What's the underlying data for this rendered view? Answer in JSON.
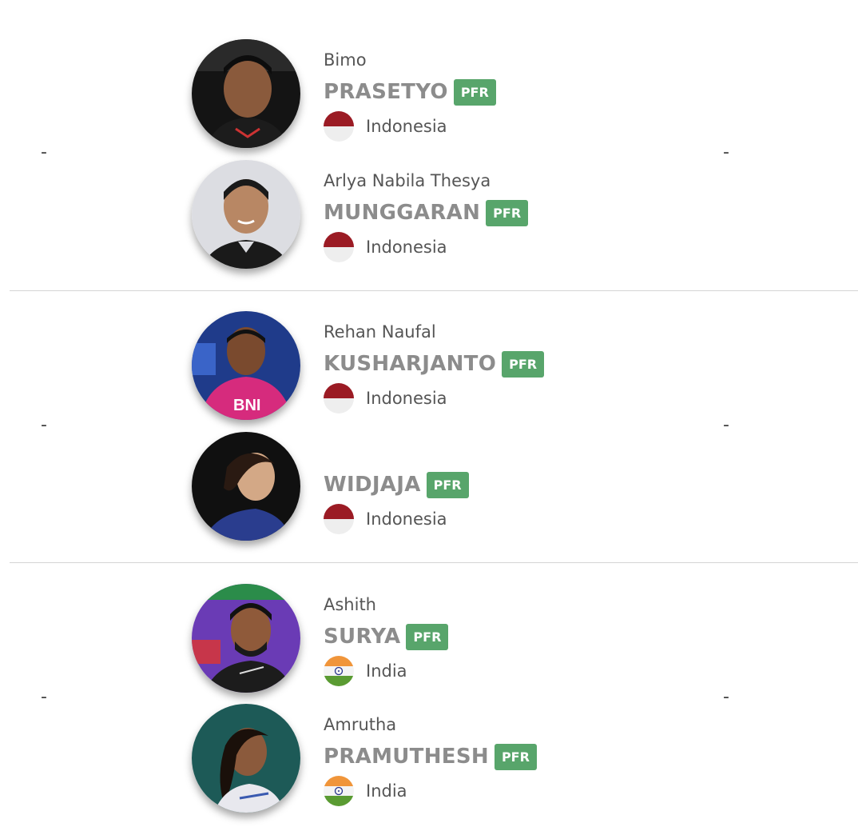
{
  "matches": [
    {
      "score_left": "-",
      "score_right": "-",
      "players": [
        {
          "first_name": "Bimo",
          "last_name": "PRASETYO",
          "badge": "PFR",
          "country": "Indonesia",
          "flag": "indonesia-flag-icon"
        },
        {
          "first_name": "Arlya Nabila Thesya",
          "last_name": "MUNGGARAN",
          "badge": "PFR",
          "country": "Indonesia",
          "flag": "indonesia-flag-icon"
        }
      ]
    },
    {
      "score_left": "-",
      "score_right": "-",
      "players": [
        {
          "first_name": "Rehan Naufal",
          "last_name": "KUSHARJANTO",
          "badge": "PFR",
          "country": "Indonesia",
          "flag": "indonesia-flag-icon"
        },
        {
          "first_name": "",
          "last_name": "WIDJAJA",
          "badge": "PFR",
          "country": "Indonesia",
          "flag": "indonesia-flag-icon"
        }
      ]
    },
    {
      "score_left": "-",
      "score_right": "-",
      "players": [
        {
          "first_name": "Ashith",
          "last_name": "SURYA",
          "badge": "PFR",
          "country": "India",
          "flag": "india-flag-icon"
        },
        {
          "first_name": "Amrutha",
          "last_name": "PRAMUTHESH",
          "badge": "PFR",
          "country": "India",
          "flag": "india-flag-icon"
        }
      ]
    }
  ],
  "colors": {
    "badge_bg": "#58a56b",
    "last_name": "#8c8c8c",
    "divider": "#d4d4d4"
  }
}
